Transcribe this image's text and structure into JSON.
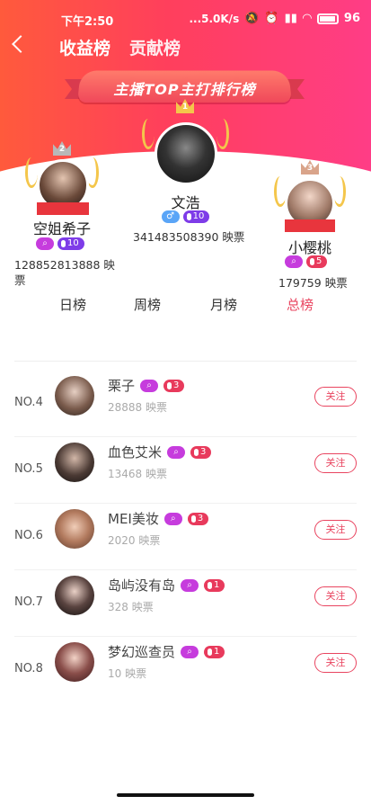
{
  "status": {
    "time": "下午2:50",
    "net": "...5.0K/s",
    "battery": "96"
  },
  "nav": {
    "tab_income": "收益榜",
    "tab_contrib": "贡献榜"
  },
  "banner": {
    "title": "主播TOP主打排行榜"
  },
  "podium": [
    {
      "rank": "1",
      "name": "文浩",
      "level": "10",
      "votes": "341483508390 映票",
      "gender": "♂"
    },
    {
      "rank": "2",
      "name": "空姐希子",
      "level": "10",
      "votes": "128852813888 映",
      "votes2": "票"
    },
    {
      "rank": "3",
      "name": "小樱桃",
      "level": "5",
      "votes": "179759 映票"
    }
  ],
  "periods": [
    "日榜",
    "周榜",
    "月榜",
    "总榜"
  ],
  "active_period": "总榜",
  "follow_label": "关注",
  "list": [
    {
      "rank": "NO.4",
      "name": "栗子",
      "level": "3",
      "votes": "28888 映票"
    },
    {
      "rank": "NO.5",
      "name": "血色艾米",
      "level": "3",
      "votes": "13468 映票"
    },
    {
      "rank": "NO.6",
      "name": "MEI美妆",
      "level": "3",
      "votes": "2020 映票"
    },
    {
      "rank": "NO.7",
      "name": "岛屿没有岛",
      "level": "1",
      "votes": "328 映票"
    },
    {
      "rank": "NO.8",
      "name": "梦幻巡查员",
      "level": "1",
      "votes": "10 映票"
    }
  ],
  "colors": {
    "accent": "#e94560",
    "gradient_start": "#ff5a3c",
    "gradient_end": "#ff3d86"
  }
}
